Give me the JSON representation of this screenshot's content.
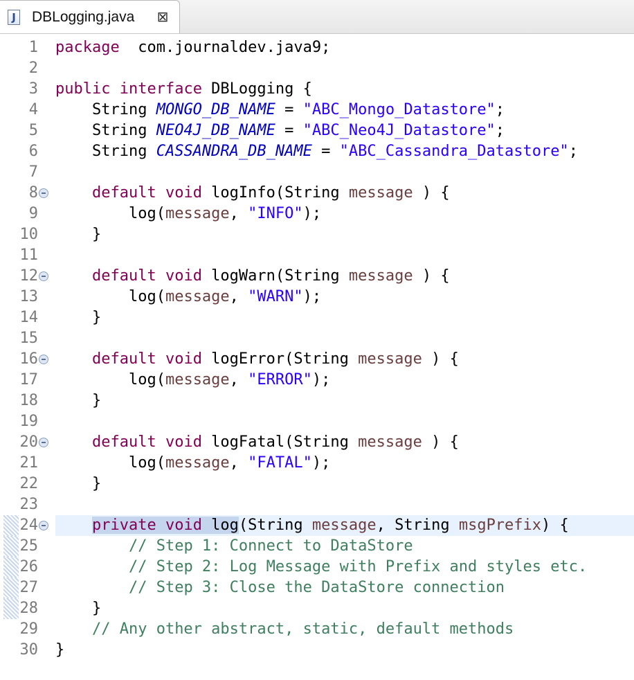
{
  "tab": {
    "title": "DBLogging.java",
    "icon": "java-file-icon",
    "close_icon": "close-icon",
    "close_glyph": "⊠"
  },
  "editor": {
    "current_line": 24,
    "lines": [
      {
        "n": "1",
        "fold": false,
        "tokens": [
          [
            "kw",
            "package"
          ],
          [
            "",
            "  com.journaldev.java9;"
          ]
        ]
      },
      {
        "n": "2",
        "fold": false,
        "tokens": []
      },
      {
        "n": "3",
        "fold": false,
        "tokens": [
          [
            "kw",
            "public"
          ],
          [
            "",
            ""
          ],
          [
            "kw",
            " interface"
          ],
          [
            "",
            " DBLogging {"
          ]
        ]
      },
      {
        "n": "4",
        "fold": false,
        "tokens": [
          [
            "",
            "    String "
          ],
          [
            "cst",
            "MONGO_DB_NAME"
          ],
          [
            "",
            " = "
          ],
          [
            "str",
            "\"ABC_Mongo_Datastore\""
          ],
          [
            "",
            ";"
          ]
        ]
      },
      {
        "n": "5",
        "fold": false,
        "tokens": [
          [
            "",
            "    String "
          ],
          [
            "cst",
            "NEO4J_DB_NAME"
          ],
          [
            "",
            " = "
          ],
          [
            "str",
            "\"ABC_Neo4J_Datastore\""
          ],
          [
            "",
            ";"
          ]
        ]
      },
      {
        "n": "6",
        "fold": false,
        "tokens": [
          [
            "",
            "    String "
          ],
          [
            "cst",
            "CASSANDRA_DB_NAME"
          ],
          [
            "",
            " = "
          ],
          [
            "str",
            "\"ABC_Cassandra_Datastore\""
          ],
          [
            "",
            ";"
          ]
        ]
      },
      {
        "n": "7",
        "fold": false,
        "tokens": []
      },
      {
        "n": "8",
        "fold": true,
        "tokens": [
          [
            "",
            "    "
          ],
          [
            "kw",
            "default"
          ],
          [
            "",
            " "
          ],
          [
            "kw",
            "void"
          ],
          [
            "",
            " logInfo(String "
          ],
          [
            "var",
            "message"
          ],
          [
            "",
            " ) {"
          ]
        ]
      },
      {
        "n": "9",
        "fold": false,
        "tokens": [
          [
            "",
            "        log("
          ],
          [
            "var",
            "message"
          ],
          [
            "",
            ", "
          ],
          [
            "str",
            "\"INFO\""
          ],
          [
            "",
            ");"
          ]
        ]
      },
      {
        "n": "10",
        "fold": false,
        "tokens": [
          [
            "",
            "    }"
          ]
        ]
      },
      {
        "n": "11",
        "fold": false,
        "tokens": []
      },
      {
        "n": "12",
        "fold": true,
        "tokens": [
          [
            "",
            "    "
          ],
          [
            "kw",
            "default"
          ],
          [
            "",
            " "
          ],
          [
            "kw",
            "void"
          ],
          [
            "",
            " logWarn(String "
          ],
          [
            "var",
            "message"
          ],
          [
            "",
            " ) {"
          ]
        ]
      },
      {
        "n": "13",
        "fold": false,
        "tokens": [
          [
            "",
            "        log("
          ],
          [
            "var",
            "message"
          ],
          [
            "",
            ", "
          ],
          [
            "str",
            "\"WARN\""
          ],
          [
            "",
            ");"
          ]
        ]
      },
      {
        "n": "14",
        "fold": false,
        "tokens": [
          [
            "",
            "    }"
          ]
        ]
      },
      {
        "n": "15",
        "fold": false,
        "tokens": []
      },
      {
        "n": "16",
        "fold": true,
        "tokens": [
          [
            "",
            "    "
          ],
          [
            "kw",
            "default"
          ],
          [
            "",
            " "
          ],
          [
            "kw",
            "void"
          ],
          [
            "",
            " logError(String "
          ],
          [
            "var",
            "message"
          ],
          [
            "",
            " ) {"
          ]
        ]
      },
      {
        "n": "17",
        "fold": false,
        "tokens": [
          [
            "",
            "        log("
          ],
          [
            "var",
            "message"
          ],
          [
            "",
            ", "
          ],
          [
            "str",
            "\"ERROR\""
          ],
          [
            "",
            ");"
          ]
        ]
      },
      {
        "n": "18",
        "fold": false,
        "tokens": [
          [
            "",
            "    }"
          ]
        ]
      },
      {
        "n": "19",
        "fold": false,
        "tokens": []
      },
      {
        "n": "20",
        "fold": true,
        "tokens": [
          [
            "",
            "    "
          ],
          [
            "kw",
            "default"
          ],
          [
            "",
            " "
          ],
          [
            "kw",
            "void"
          ],
          [
            "",
            " logFatal(String "
          ],
          [
            "var",
            "message"
          ],
          [
            "",
            " ) {"
          ]
        ]
      },
      {
        "n": "21",
        "fold": false,
        "tokens": [
          [
            "",
            "        log("
          ],
          [
            "var",
            "message"
          ],
          [
            "",
            ", "
          ],
          [
            "str",
            "\"FATAL\""
          ],
          [
            "",
            ");"
          ]
        ]
      },
      {
        "n": "22",
        "fold": false,
        "tokens": [
          [
            "",
            "    }"
          ]
        ]
      },
      {
        "n": "23",
        "fold": false,
        "tokens": []
      },
      {
        "n": "24",
        "fold": true,
        "tokens": [
          [
            "",
            "    "
          ],
          [
            "kw sel",
            "private"
          ],
          [
            "sel",
            " "
          ],
          [
            "kw sel",
            "void"
          ],
          [
            "sel",
            " log"
          ],
          [
            "",
            "(String "
          ],
          [
            "var",
            "message"
          ],
          [
            "",
            ", String "
          ],
          [
            "var",
            "msgPrefix"
          ],
          [
            "",
            ") {"
          ]
        ]
      },
      {
        "n": "25",
        "fold": false,
        "tokens": [
          [
            "",
            "        "
          ],
          [
            "cmt",
            "// Step 1: Connect to DataStore"
          ]
        ]
      },
      {
        "n": "26",
        "fold": false,
        "tokens": [
          [
            "",
            "        "
          ],
          [
            "cmt",
            "// Step 2: Log Message with Prefix and styles etc."
          ]
        ]
      },
      {
        "n": "27",
        "fold": false,
        "tokens": [
          [
            "",
            "        "
          ],
          [
            "cmt",
            "// Step 3: Close the DataStore connection"
          ]
        ]
      },
      {
        "n": "28",
        "fold": false,
        "tokens": [
          [
            "",
            "    }"
          ]
        ]
      },
      {
        "n": "29",
        "fold": false,
        "tokens": [
          [
            "",
            "    "
          ],
          [
            "cmt",
            "// Any other abstract, static, default methods"
          ]
        ]
      },
      {
        "n": "30",
        "fold": false,
        "tokens": [
          [
            "",
            "}"
          ]
        ]
      }
    ]
  },
  "colors": {
    "keyword": "#7f0055",
    "string": "#2a00ff",
    "constant": "#0000c0",
    "variable": "#6a3e3e",
    "comment": "#3f7f5f",
    "current_line_bg": "#e8f2fe"
  }
}
